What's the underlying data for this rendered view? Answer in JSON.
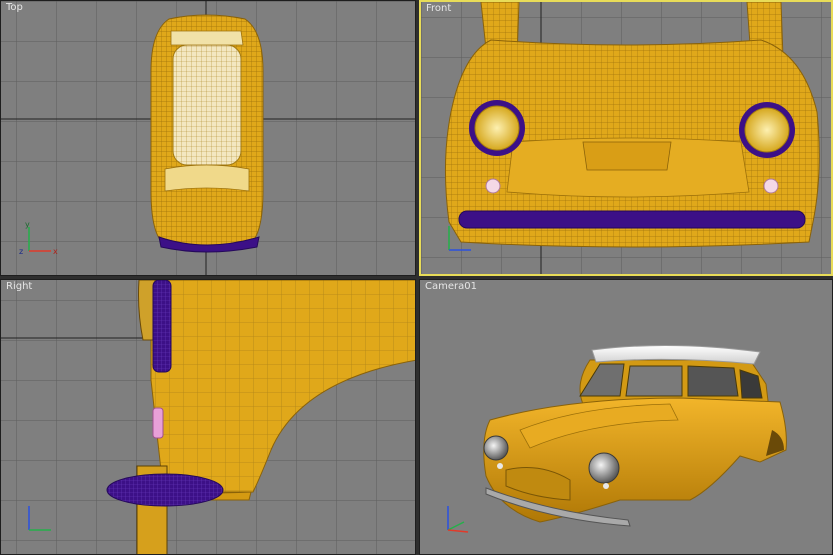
{
  "viewports": {
    "top": {
      "label": "Top"
    },
    "front": {
      "label": "Front"
    },
    "right": {
      "label": "Right"
    },
    "camera": {
      "label": "Camera01"
    }
  },
  "axis_labels": {
    "x": "x",
    "y": "y",
    "z": "z"
  },
  "colors": {
    "viewport_bg": "#7f7f7f",
    "grid": "#5e5e5e",
    "grid_major": "#2a2a2a",
    "mesh_body": "#e0a81a",
    "mesh_lines": "#a8790c",
    "bumper": "#3c1087",
    "active_border": "#e8dc58",
    "roof": "#f2f2f2"
  },
  "active_viewport": "front"
}
